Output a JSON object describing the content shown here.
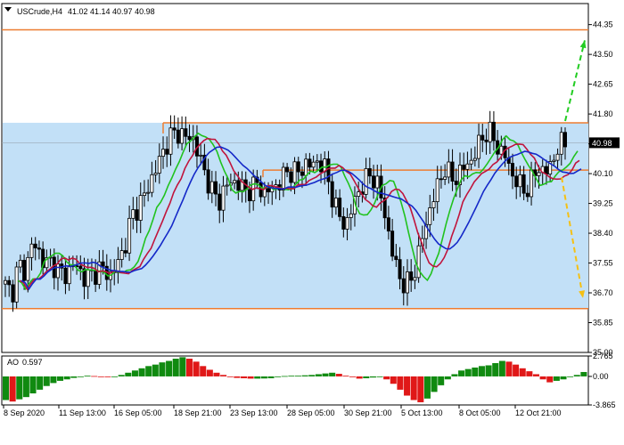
{
  "header": {
    "symbol": "USCrude,H4",
    "ohlc": "41.02 41.14 40.97 40.98"
  },
  "indicator": {
    "name": "AO",
    "value": "0.597",
    "ylabels": [
      "2.765",
      "0.00",
      "-3.865"
    ]
  },
  "colors": {
    "range_fill": "#c2e0f7",
    "level_line": "#ed7d31",
    "ma_fast": "#21c21e",
    "ma_mid": "#c0143c",
    "ma_slow": "#1428c8",
    "arrow_up": "#22cc22",
    "arrow_down": "#f5c014",
    "ao_up": "#108a10",
    "ao_down": "#e01818",
    "price_badge": "#000000"
  },
  "chart_data": [
    {
      "type": "candlestick",
      "symbol": "USCrude",
      "timeframe": "H4",
      "x_tick_labels": [
        "8 Sep 2020",
        "11 Sep 13:00",
        "16 Sep 05:00",
        "18 Sep 21:00",
        "23 Sep 13:00",
        "28 Sep 05:00",
        "30 Sep 21:00",
        "5 Oct 13:00",
        "8 Oct 05:00",
        "12 Oct 21:00"
      ],
      "y_tick_labels": [
        "44.35",
        "43.50",
        "42.65",
        "41.80",
        "40.95",
        "40.10",
        "39.25",
        "38.40",
        "37.55",
        "36.70",
        "35.85",
        "35.00"
      ],
      "ylim": [
        35.0,
        44.95
      ],
      "current_price": "40.98",
      "levels": [
        44.2,
        41.55,
        40.2,
        36.25
      ],
      "range_band": [
        36.25,
        41.55
      ],
      "forecast_arrows": [
        {
          "direction": "up",
          "from": 41.6,
          "to": 43.9
        },
        {
          "direction": "down",
          "from": 40.0,
          "to": 36.55
        }
      ],
      "close_path": [
        36.9,
        36.7,
        37.5,
        37.3,
        38.1,
        37.9,
        37.5,
        37.6,
        37.3,
        37.2,
        37.5,
        37.4,
        37.1,
        37.2,
        37.4,
        37.3,
        37.2,
        37.6,
        38.1,
        38.9,
        39.2,
        39.5,
        40.0,
        40.4,
        40.9,
        41.2,
        41.3,
        41.1,
        41.2,
        40.6,
        40.1,
        39.6,
        39.3,
        39.7,
        39.9,
        39.8,
        39.6,
        39.7,
        39.8,
        39.5,
        39.7,
        39.8,
        40.1,
        40.2,
        40.1,
        40.4,
        40.3,
        40.5,
        40.2,
        39.5,
        38.9,
        38.6,
        39.1,
        39.6,
        39.9,
        40.1,
        39.7,
        38.9,
        37.9,
        37.2,
        36.9,
        37.1,
        37.8,
        38.6,
        39.3,
        39.8,
        40.3,
        39.9,
        40.1,
        40.3,
        40.5,
        40.9,
        41.3,
        41.2,
        40.8,
        40.6,
        40.1,
        39.8,
        39.6,
        39.9,
        40.3,
        40.1,
        40.4,
        40.9,
        40.98
      ]
    },
    {
      "type": "bar",
      "name": "AO",
      "ylim": [
        -3.865,
        2.765
      ],
      "y_tick_labels": [
        "2.765",
        "0.00",
        "-3.865"
      ],
      "last_value": 0.597,
      "values": [
        -3.2,
        -3.4,
        -3.1,
        -2.8,
        -2.3,
        -1.8,
        -1.3,
        -0.9,
        -0.6,
        -0.4,
        -0.2,
        0.0,
        0.1,
        0.05,
        -0.05,
        -0.1,
        0.0,
        0.2,
        0.5,
        0.8,
        1.1,
        1.4,
        1.6,
        1.9,
        2.1,
        2.4,
        2.6,
        2.4,
        2.0,
        1.4,
        0.9,
        0.5,
        0.2,
        0.0,
        -0.2,
        -0.25,
        -0.3,
        -0.3,
        -0.28,
        -0.25,
        -0.1,
        0.05,
        0.1,
        0.1,
        0.15,
        0.2,
        0.3,
        0.4,
        0.5,
        0.35,
        0.1,
        -0.1,
        -0.3,
        -0.25,
        -0.15,
        -0.1,
        -0.4,
        -1.0,
        -1.8,
        -2.6,
        -3.2,
        -3.5,
        -3.0,
        -2.1,
        -1.2,
        -0.4,
        0.3,
        0.8,
        1.0,
        1.2,
        1.4,
        1.5,
        1.8,
        2.1,
        2.0,
        1.6,
        1.1,
        0.7,
        0.3,
        -0.4,
        -0.8,
        -0.6,
        -0.4,
        -0.1,
        0.2,
        0.597
      ]
    }
  ]
}
